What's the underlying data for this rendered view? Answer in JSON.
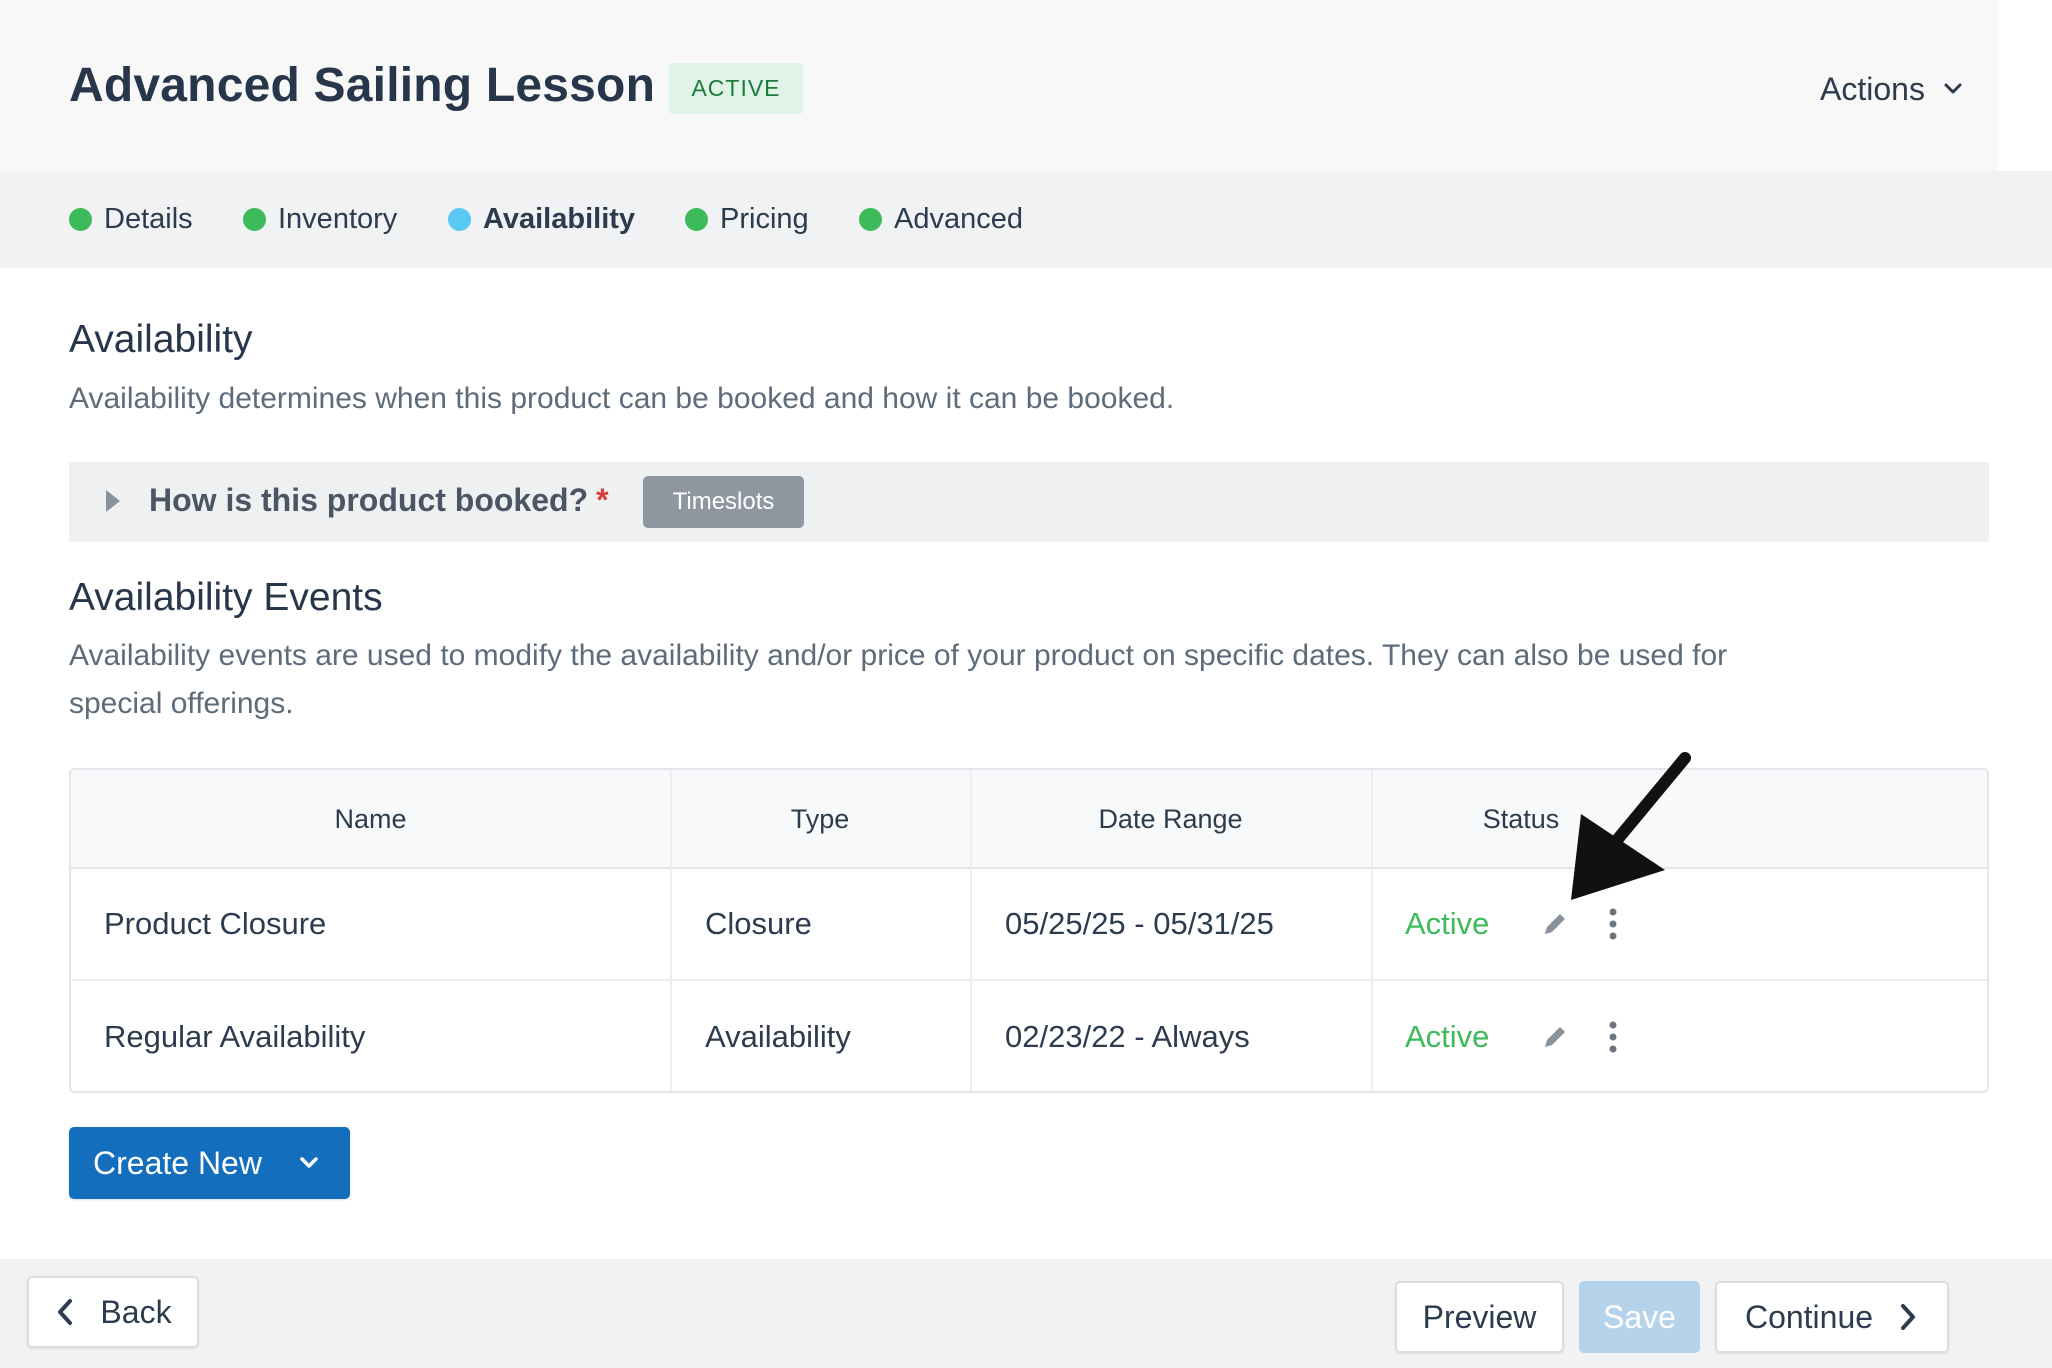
{
  "header": {
    "title": "Advanced Sailing Lesson",
    "status_badge": "ACTIVE",
    "actions_label": "Actions"
  },
  "steps": [
    {
      "label": "Details",
      "state": "complete"
    },
    {
      "label": "Inventory",
      "state": "complete"
    },
    {
      "label": "Availability",
      "state": "current"
    },
    {
      "label": "Pricing",
      "state": "complete"
    },
    {
      "label": "Advanced",
      "state": "complete"
    }
  ],
  "availability": {
    "heading": "Availability",
    "description": "Availability determines when this product can be booked and how it can be booked.",
    "booked_question": "How is this product booked?",
    "required_marker": "*",
    "booking_type": "Timeslots"
  },
  "events": {
    "heading": "Availability Events",
    "description_line1": "Availability events are used to modify the availability and/or price of your product on specific dates. They can also be used for",
    "description_line2": "special offerings.",
    "columns": [
      "Name",
      "Type",
      "Date Range",
      "Status"
    ],
    "rows": [
      {
        "name": "Product Closure",
        "type": "Closure",
        "date_range": "05/25/25 - 05/31/25",
        "status": "Active"
      },
      {
        "name": "Regular Availability",
        "type": "Availability",
        "date_range": "02/23/22 - Always",
        "status": "Active"
      }
    ],
    "create_new_label": "Create New"
  },
  "footer": {
    "back_label": "Back",
    "preview_label": "Preview",
    "save_label": "Save",
    "continue_label": "Continue"
  },
  "colors": {
    "complete_dot": "#3dba5a",
    "current_dot": "#5ac8f5",
    "primary_button": "#136fbd",
    "status_active": "#3dba5a"
  },
  "icons": [
    "chevron-down-icon",
    "caret-right-icon",
    "pencil-icon",
    "vertical-dots-icon",
    "chevron-left-icon",
    "chevron-right-icon",
    "annotation-arrow-icon"
  ]
}
